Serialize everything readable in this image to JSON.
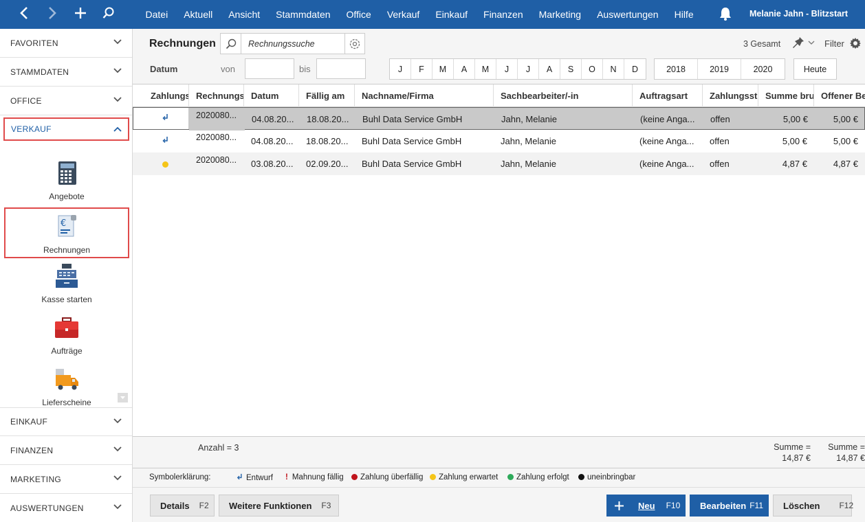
{
  "topbar": {
    "nav": {
      "back": "‹",
      "forward": "›",
      "add": "+",
      "search": "⌕"
    },
    "menu": [
      "Datei",
      "Aktuell",
      "Ansicht",
      "Stammdaten",
      "Office",
      "Verkauf",
      "Einkauf",
      "Finanzen",
      "Marketing",
      "Auswertungen",
      "Hilfe"
    ],
    "user": "Melanie Jahn - Blitzstart"
  },
  "sidebar": {
    "sections_top": [
      "FAVORITEN",
      "STAMMDATEN",
      "OFFICE"
    ],
    "active_section": "VERKAUF",
    "tiles": [
      "Angebote",
      "Rechnungen",
      "Kasse starten",
      "Aufträge",
      "Lieferscheine"
    ],
    "sections_bottom": [
      "EINKAUF",
      "FINANZEN",
      "MARKETING",
      "AUSWERTUNGEN"
    ]
  },
  "header": {
    "title": "Rechnungen",
    "search_placeholder": "Rechnungssuche",
    "total": "3 Gesamt",
    "filter": "Filter",
    "datum": "Datum",
    "von": "von",
    "bis": "bis",
    "months": [
      "J",
      "F",
      "M",
      "A",
      "M",
      "J",
      "J",
      "A",
      "S",
      "O",
      "N",
      "D"
    ],
    "years": [
      "2018",
      "2019",
      "2020"
    ],
    "heute": "Heute"
  },
  "table": {
    "columns": [
      "Zahlungs",
      "Rechnungs",
      "Datum",
      "Fällig am",
      "Nachname/Firma",
      "Sachbearbeiter/-in",
      "Auftragsart",
      "Zahlungsst",
      "Summe bru",
      "Offener Be"
    ],
    "rows": [
      {
        "status": "draft",
        "nr": "2020080...",
        "datum": "04.08.20...",
        "faellig": "18.08.20...",
        "firma": "Buhl Data Service GmbH",
        "sb": "Jahn, Melanie",
        "art": "(keine Anga...",
        "zst": "offen",
        "summe": "5,00 €",
        "offen": "5,00 €"
      },
      {
        "status": "draft",
        "nr": "2020080...",
        "datum": "04.08.20...",
        "faellig": "18.08.20...",
        "firma": "Buhl Data Service GmbH",
        "sb": "Jahn, Melanie",
        "art": "(keine Anga...",
        "zst": "offen",
        "summe": "5,00 €",
        "offen": "5,00 €"
      },
      {
        "status": "expected",
        "nr": "2020080...",
        "datum": "03.08.20...",
        "faellig": "02.09.20...",
        "firma": "Buhl Data Service GmbH",
        "sb": "Jahn, Melanie",
        "art": "(keine Anga...",
        "zst": "offen",
        "summe": "4,87 €",
        "offen": "4,87 €"
      }
    ],
    "selected_row": 0
  },
  "summary": {
    "anzahl": "Anzahl = 3",
    "summe_label": "Summe =",
    "summe_brutto": "14,87 €",
    "summe_offen": "14,87 €"
  },
  "legend": {
    "title": "Symbolerklärung:",
    "items": [
      {
        "label": "Entwurf",
        "icon": "draft-icon"
      },
      {
        "label": "Mahnung fällig",
        "icon": "exclamation-icon",
        "color": "#c0141c"
      },
      {
        "label": "Zahlung überfällig",
        "color": "#c0141c"
      },
      {
        "label": "Zahlung erwartet",
        "color": "#f5c518"
      },
      {
        "label": "Zahlung erfolgt",
        "color": "#2eaa5a"
      },
      {
        "label": "uneinbringbar",
        "color": "#111111"
      }
    ]
  },
  "buttons": {
    "details": {
      "label": "Details",
      "key": "F2"
    },
    "weitere": {
      "label": "Weitere Funktionen",
      "key": "F3"
    },
    "neu": {
      "label": "Neu",
      "key": "F10"
    },
    "bearbeiten": {
      "label": "Bearbeiten",
      "key": "F11"
    },
    "loeschen": {
      "label": "Löschen",
      "key": "F12"
    }
  },
  "colors": {
    "brand": "#1f5fa6",
    "highlight": "#e04a4a"
  }
}
